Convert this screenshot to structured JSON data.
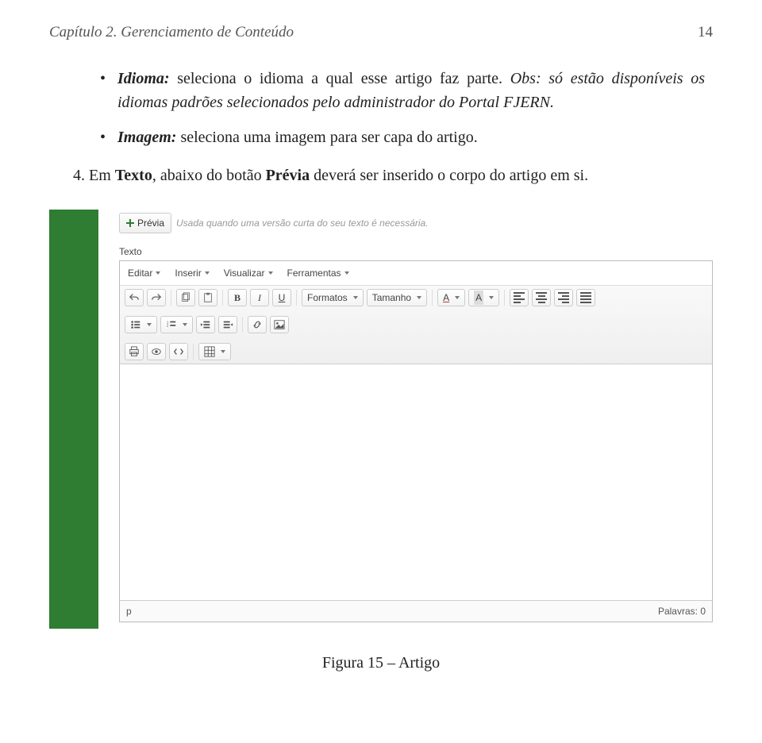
{
  "header": {
    "chapter": "Capítulo 2.   Gerenciamento de Conteúdo",
    "page_number": "14"
  },
  "bullets": {
    "idioma": {
      "label": "Idioma:",
      "text": " seleciona o idioma a qual esse artigo faz parte. ",
      "obs": "Obs: só estão disponíveis os idiomas padrões selecionados pelo administrador do Portal FJERN."
    },
    "imagem": {
      "label": "Imagem:",
      "text": " seleciona uma imagem para ser capa do artigo."
    }
  },
  "num_item": {
    "num": "4.",
    "pre": "Em ",
    "texto": "Texto",
    "mid": ", abaixo do botão ",
    "previa": "Prévia",
    "post": " deverá ser inserido o corpo do artigo em si."
  },
  "editor": {
    "previa_button": "Prévia",
    "hint": "Usada quando uma versão curta do seu texto é necessária.",
    "texto_label": "Texto",
    "menu": {
      "editar": "Editar",
      "inserir": "Inserir",
      "visualizar": "Visualizar",
      "ferramentas": "Ferramentas"
    },
    "combos": {
      "formatos": "Formatos",
      "tamanho": "Tamanho"
    },
    "status": {
      "path": "p",
      "words_label": "Palavras:",
      "words_count": "0"
    }
  },
  "caption": "Figura 15 – Artigo"
}
